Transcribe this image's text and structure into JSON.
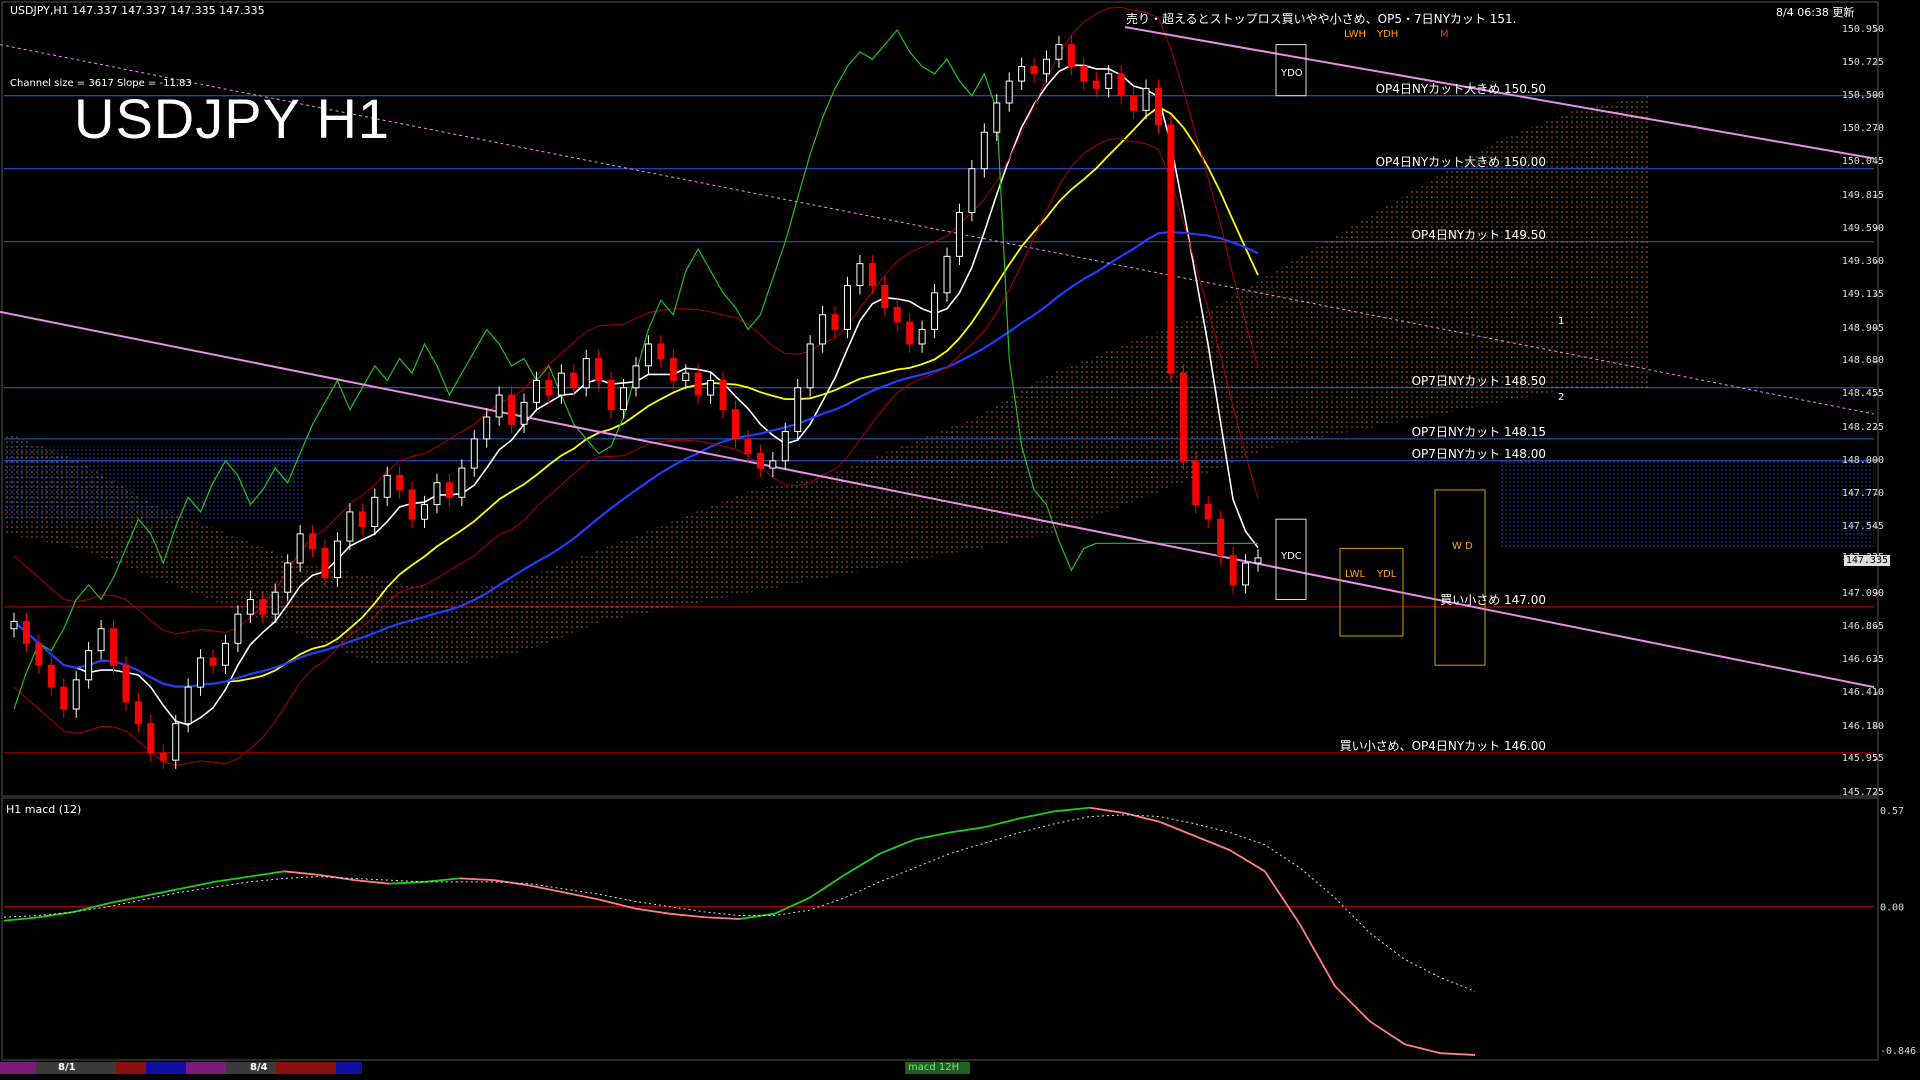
{
  "header": {
    "ticker_line": "USDJPY,H1  147.337 147.337 147.335 147.335",
    "channel_info": "Channel size = 3617 Slope = -11.83",
    "title": "USDJPY H1",
    "timestamp": "8/4 06:38 更新",
    "top_note": "売り・超えるとストップロス買いやや小さめ、OP5・7日NYカット 151."
  },
  "macd_header": "H1  macd (12)",
  "current_price": "147.335",
  "colors": {
    "background": "#000000",
    "grid_blue": "#2b5fd9",
    "grid_red": "#c00000",
    "bull_candle": "#ffffff",
    "bear_candle": "#ff0000",
    "ma_fast": "#ffffff",
    "ma_mid": "#ffff00",
    "ma_slow": "#1f3fff",
    "channel_pink": "#e88ee8",
    "chikou_green": "#22c022",
    "macd_up": "#22cc22",
    "macd_down": "#ff8080"
  },
  "order_levels": [
    {
      "price": 150.5,
      "text": "OP4日NYカット大きめ 150.50"
    },
    {
      "price": 150.0,
      "text": "OP4日NYカット大きめ 150.00"
    },
    {
      "price": 149.5,
      "text": "OP4日NYカット 149.50"
    },
    {
      "price": 148.5,
      "text": "OP7日NYカット 148.50"
    },
    {
      "price": 148.15,
      "text": "OP7日NYカット 148.15"
    },
    {
      "price": 148.0,
      "text": "OP7日NYカット 148.00"
    },
    {
      "price": 147.0,
      "text": "買い小さめ 147.00"
    },
    {
      "price": 146.0,
      "text": "買い小さめ、OP4日NYカット 146.00"
    }
  ],
  "box_labels": {
    "ydo": "YDO",
    "ydc": "YDC",
    "lwh": "LWH",
    "ydh": "YDH",
    "lwl": "LWL",
    "ydl": "YDL",
    "m": "M",
    "wd": "W D",
    "line1": "1",
    "line2": "2"
  },
  "bottom_dates": [
    "8/1",
    "8/4"
  ],
  "macd_tag": "macd 12H",
  "chart_data": {
    "type": "candlestick",
    "title": "USDJPY H1",
    "ylim": [
      145.725,
      150.95
    ],
    "y_ticks": [
      150.95,
      150.725,
      150.5,
      150.27,
      150.045,
      149.815,
      149.59,
      149.36,
      149.135,
      148.905,
      148.68,
      148.455,
      148.225,
      148.0,
      147.77,
      147.545,
      147.335,
      147.09,
      146.865,
      146.635,
      146.41,
      146.18,
      145.955,
      145.725
    ],
    "y_tick_labels": [
      "150.950",
      "150.725",
      "150.500",
      "150.270",
      "150.045",
      "149.815",
      "149.590",
      "149.360",
      "149.135",
      "148.905",
      "148.680",
      "148.455",
      "148.225",
      "148.000",
      "147.770",
      "147.545",
      "147.335",
      "147.090",
      "146.865",
      "146.635",
      "146.410",
      "146.180",
      "145.955",
      "145.725"
    ],
    "candles_close": [
      146.9,
      146.75,
      146.6,
      146.45,
      146.3,
      146.5,
      146.7,
      146.85,
      146.6,
      146.35,
      146.2,
      146.0,
      145.95,
      146.2,
      146.45,
      146.65,
      146.6,
      146.75,
      146.95,
      147.05,
      146.95,
      147.1,
      147.3,
      147.5,
      147.4,
      147.2,
      147.45,
      147.65,
      147.55,
      147.75,
      147.9,
      147.8,
      147.6,
      147.7,
      147.85,
      147.75,
      147.95,
      148.15,
      148.3,
      148.45,
      148.25,
      148.4,
      148.55,
      148.45,
      148.6,
      148.5,
      148.7,
      148.55,
      148.35,
      148.5,
      148.65,
      148.8,
      148.7,
      148.55,
      148.6,
      148.45,
      148.55,
      148.35,
      148.15,
      148.05,
      147.95,
      148.0,
      148.2,
      148.5,
      148.8,
      149.0,
      148.9,
      149.2,
      149.35,
      149.2,
      149.05,
      148.95,
      148.8,
      148.9,
      149.15,
      149.4,
      149.7,
      150.0,
      150.25,
      150.45,
      150.6,
      150.7,
      150.65,
      150.75,
      150.85,
      150.7,
      150.6,
      150.55,
      150.65,
      150.5,
      150.4,
      150.55,
      150.3,
      148.6,
      148.0,
      147.7,
      147.6,
      147.35,
      147.15,
      147.3,
      147.335
    ],
    "macd": [
      -0.08,
      -0.06,
      -0.03,
      0.02,
      0.06,
      0.1,
      0.14,
      0.17,
      0.2,
      0.18,
      0.15,
      0.13,
      0.14,
      0.16,
      0.15,
      0.12,
      0.08,
      0.04,
      -0.01,
      -0.04,
      -0.06,
      -0.07,
      -0.04,
      0.05,
      0.18,
      0.3,
      0.38,
      0.42,
      0.45,
      0.5,
      0.54,
      0.56,
      0.53,
      0.48,
      0.4,
      0.32,
      0.2,
      -0.1,
      -0.45,
      -0.65,
      -0.78,
      -0.83,
      -0.84
    ],
    "macd_signal": [
      -0.06,
      -0.05,
      -0.03,
      0.0,
      0.04,
      0.08,
      0.11,
      0.14,
      0.16,
      0.17,
      0.16,
      0.15,
      0.14,
      0.14,
      0.14,
      0.13,
      0.1,
      0.07,
      0.03,
      0.0,
      -0.03,
      -0.05,
      -0.05,
      -0.02,
      0.05,
      0.14,
      0.22,
      0.3,
      0.36,
      0.42,
      0.47,
      0.51,
      0.52,
      0.51,
      0.47,
      0.42,
      0.35,
      0.22,
      0.05,
      -0.15,
      -0.3,
      -0.4,
      -0.48
    ],
    "macd_ylim": [
      -0.846,
      0.57
    ],
    "macd_ticks": [
      "0.57",
      "0.00",
      "-0.846"
    ]
  }
}
